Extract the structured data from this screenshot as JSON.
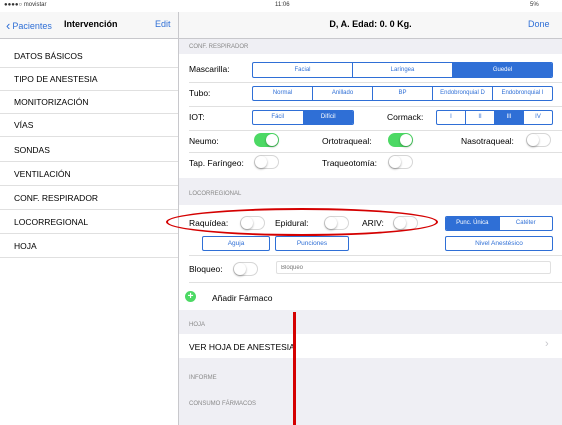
{
  "status_bar": {
    "carrier": "●●●●○ movistar",
    "time": "11:06",
    "battery": "5%"
  },
  "sidebar": {
    "back_label": "Pacientes",
    "title": "Intervención",
    "edit_label": "Edit",
    "items": [
      {
        "label": "DATOS BÁSICOS"
      },
      {
        "label": "TIPO DE ANESTESIA"
      },
      {
        "label": "MONITORIZACIÓN"
      },
      {
        "label": "VÍAS"
      },
      {
        "label": "SONDAS"
      },
      {
        "label": "VENTILACIÓN"
      },
      {
        "label": "CONF. RESPIRADOR"
      },
      {
        "label": "LOCORREGIONAL"
      },
      {
        "label": "HOJA"
      }
    ]
  },
  "header": {
    "title": "D, A. Edad: 0. 0 Kg.",
    "done_label": "Done"
  },
  "conf_respirador": {
    "section_header": "CONF. RESPIRADOR",
    "mascarilla": {
      "label": "Mascarilla:",
      "options": [
        "Facial",
        "Laríngea",
        "Guedel"
      ],
      "selected": 2
    },
    "tubo": {
      "label": "Tubo:",
      "options": [
        "Normal",
        "Anillado",
        "BP",
        "Endobronquial D",
        "Endobronquial I"
      ],
      "selected": -1
    },
    "iot": {
      "label": "IOT:",
      "options": [
        "Fácil",
        "Difícil"
      ],
      "selected": 1
    },
    "cormack": {
      "label": "Cormack:",
      "options": [
        "I",
        "II",
        "III",
        "IV"
      ],
      "selected": 2
    },
    "neumo": {
      "label": "Neumo:",
      "on": true
    },
    "ortotraqueal": {
      "label": "Ortotraqueal:",
      "on": true
    },
    "nasotraqueal": {
      "label": "Nasotraqueal:",
      "on": false
    },
    "tap_faringeo": {
      "label": "Tap. Faríngeo:",
      "on": false
    },
    "traqueotomia": {
      "label": "Traqueotomía:",
      "on": false
    }
  },
  "locorregional": {
    "section_header": "LOCORREGIONAL",
    "raquidea": {
      "label": "Raquídea:",
      "on": false
    },
    "epidural": {
      "label": "Epidural:",
      "on": false
    },
    "ariv": {
      "label": "ARIV:",
      "on": false
    },
    "punc_options": [
      "Punc. Única",
      "Catéter"
    ],
    "punc_selected": 0,
    "aguja_label": "Aguja",
    "punciones_label": "Punciones",
    "nivel_label": "Nivel Anestésico",
    "bloqueo": {
      "label": "Bloqueo:",
      "on": false,
      "placeholder": "Bloqueo"
    },
    "add_farmaco_label": "Añadir Fármaco"
  },
  "hoja": {
    "section_header": "HOJA",
    "ver_hoja_label": "VER HOJA DE ANESTESIA"
  },
  "informe": {
    "section_header": "INFORME"
  },
  "consumo": {
    "section_header": "CONSUMO FÁRMACOS"
  }
}
